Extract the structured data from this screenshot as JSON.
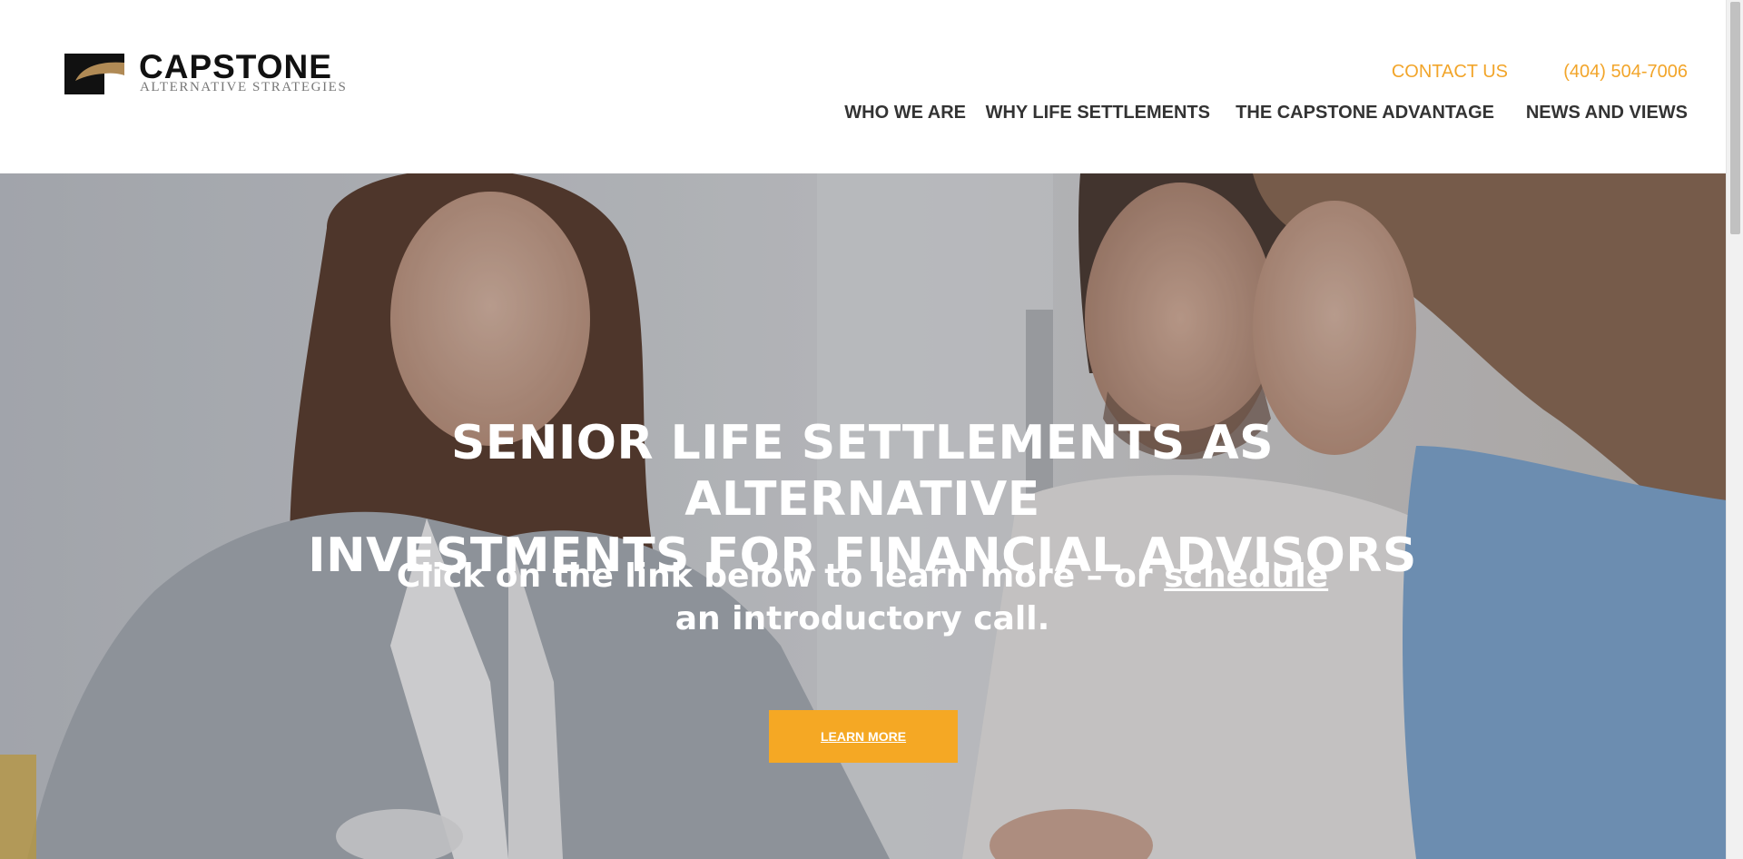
{
  "brand": {
    "name": "CAPSTONE",
    "tagline": "ALTERNATIVE STRATEGIES",
    "colors": {
      "accent": "#f2a52a",
      "button": "#f5a824",
      "nav_text": "#333333",
      "logo_gold": "#b08a55"
    }
  },
  "utility_links": {
    "contact": "CONTACT US",
    "phone": "(404) 504-7006"
  },
  "nav": {
    "items": [
      {
        "label": "WHO WE ARE"
      },
      {
        "label": "WHY LIFE SETTLEMENTS"
      },
      {
        "label": "THE CAPSTONE ADVANTAGE"
      },
      {
        "label": "NEWS AND VIEWS"
      }
    ]
  },
  "hero": {
    "title_line1": "SENIOR LIFE SETTLEMENTS AS ALTERNATIVE",
    "title_line2": "INVESTMENTS FOR FINANCIAL ADVISORS",
    "sub_before": "Click on the link below to learn more – or ",
    "sub_link": "schedule",
    "sub_after": " an introductory call.",
    "button_label": "LEARN MORE"
  },
  "icons": {
    "logo": "capstone-logo-mark"
  }
}
